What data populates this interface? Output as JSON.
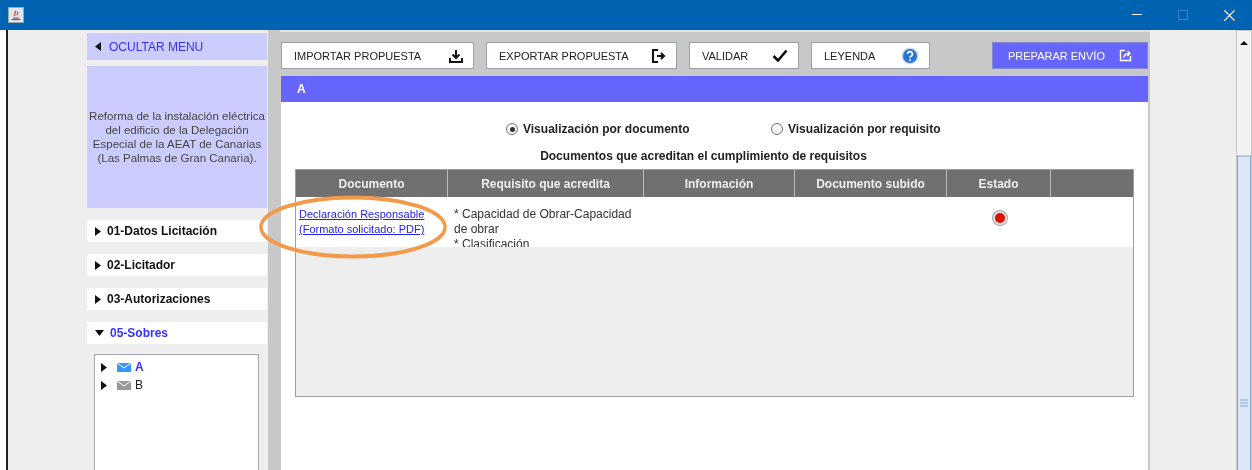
{
  "sidebar": {
    "hide_menu": "OCULTAR MENU",
    "description": "Reforma de la instalación eléctrica del edificio de la Delegación Especial de la AEAT de Canarias (Las Palmas de Gran Canaria).",
    "sections": [
      {
        "label": "01-Datos Licitación",
        "expanded": false,
        "selected": false
      },
      {
        "label": "02-Licitador",
        "expanded": false,
        "selected": false
      },
      {
        "label": "03-Autorizaciones",
        "expanded": false,
        "selected": false
      },
      {
        "label": "05-Sobres",
        "expanded": true,
        "selected": true
      }
    ],
    "tree": [
      {
        "label": "A",
        "selected": true
      },
      {
        "label": "B",
        "selected": false
      }
    ]
  },
  "toolbar": {
    "buttons": [
      {
        "label": "IMPORTAR PROPUESTA",
        "kind": "import"
      },
      {
        "label": "EXPORTAR PROPUESTA",
        "kind": "export"
      },
      {
        "label": "VALIDAR",
        "kind": "validate"
      },
      {
        "label": "LEYENDA",
        "kind": "help"
      }
    ],
    "send_button": "PREPARAR ENVÍO"
  },
  "panel": {
    "title": "A",
    "view_options": [
      {
        "label": "Visualización por documento",
        "selected": true
      },
      {
        "label": "Visualización por requisito",
        "selected": false
      }
    ],
    "table": {
      "caption": "Documentos que acreditan el cumplimiento de requisitos",
      "columns": [
        "Documento",
        "Requisito que acredita",
        "Información",
        "Documento subido",
        "Estado"
      ],
      "rows": [
        {
          "document": "Declaración Responsable (Formato solicitado: PDF)",
          "requirements": [
            "* Capacidad de Obrar-Capacidad de obrar",
            "* Clasificación"
          ],
          "color": "#dd1100",
          "highlighted": true
        }
      ]
    }
  }
}
